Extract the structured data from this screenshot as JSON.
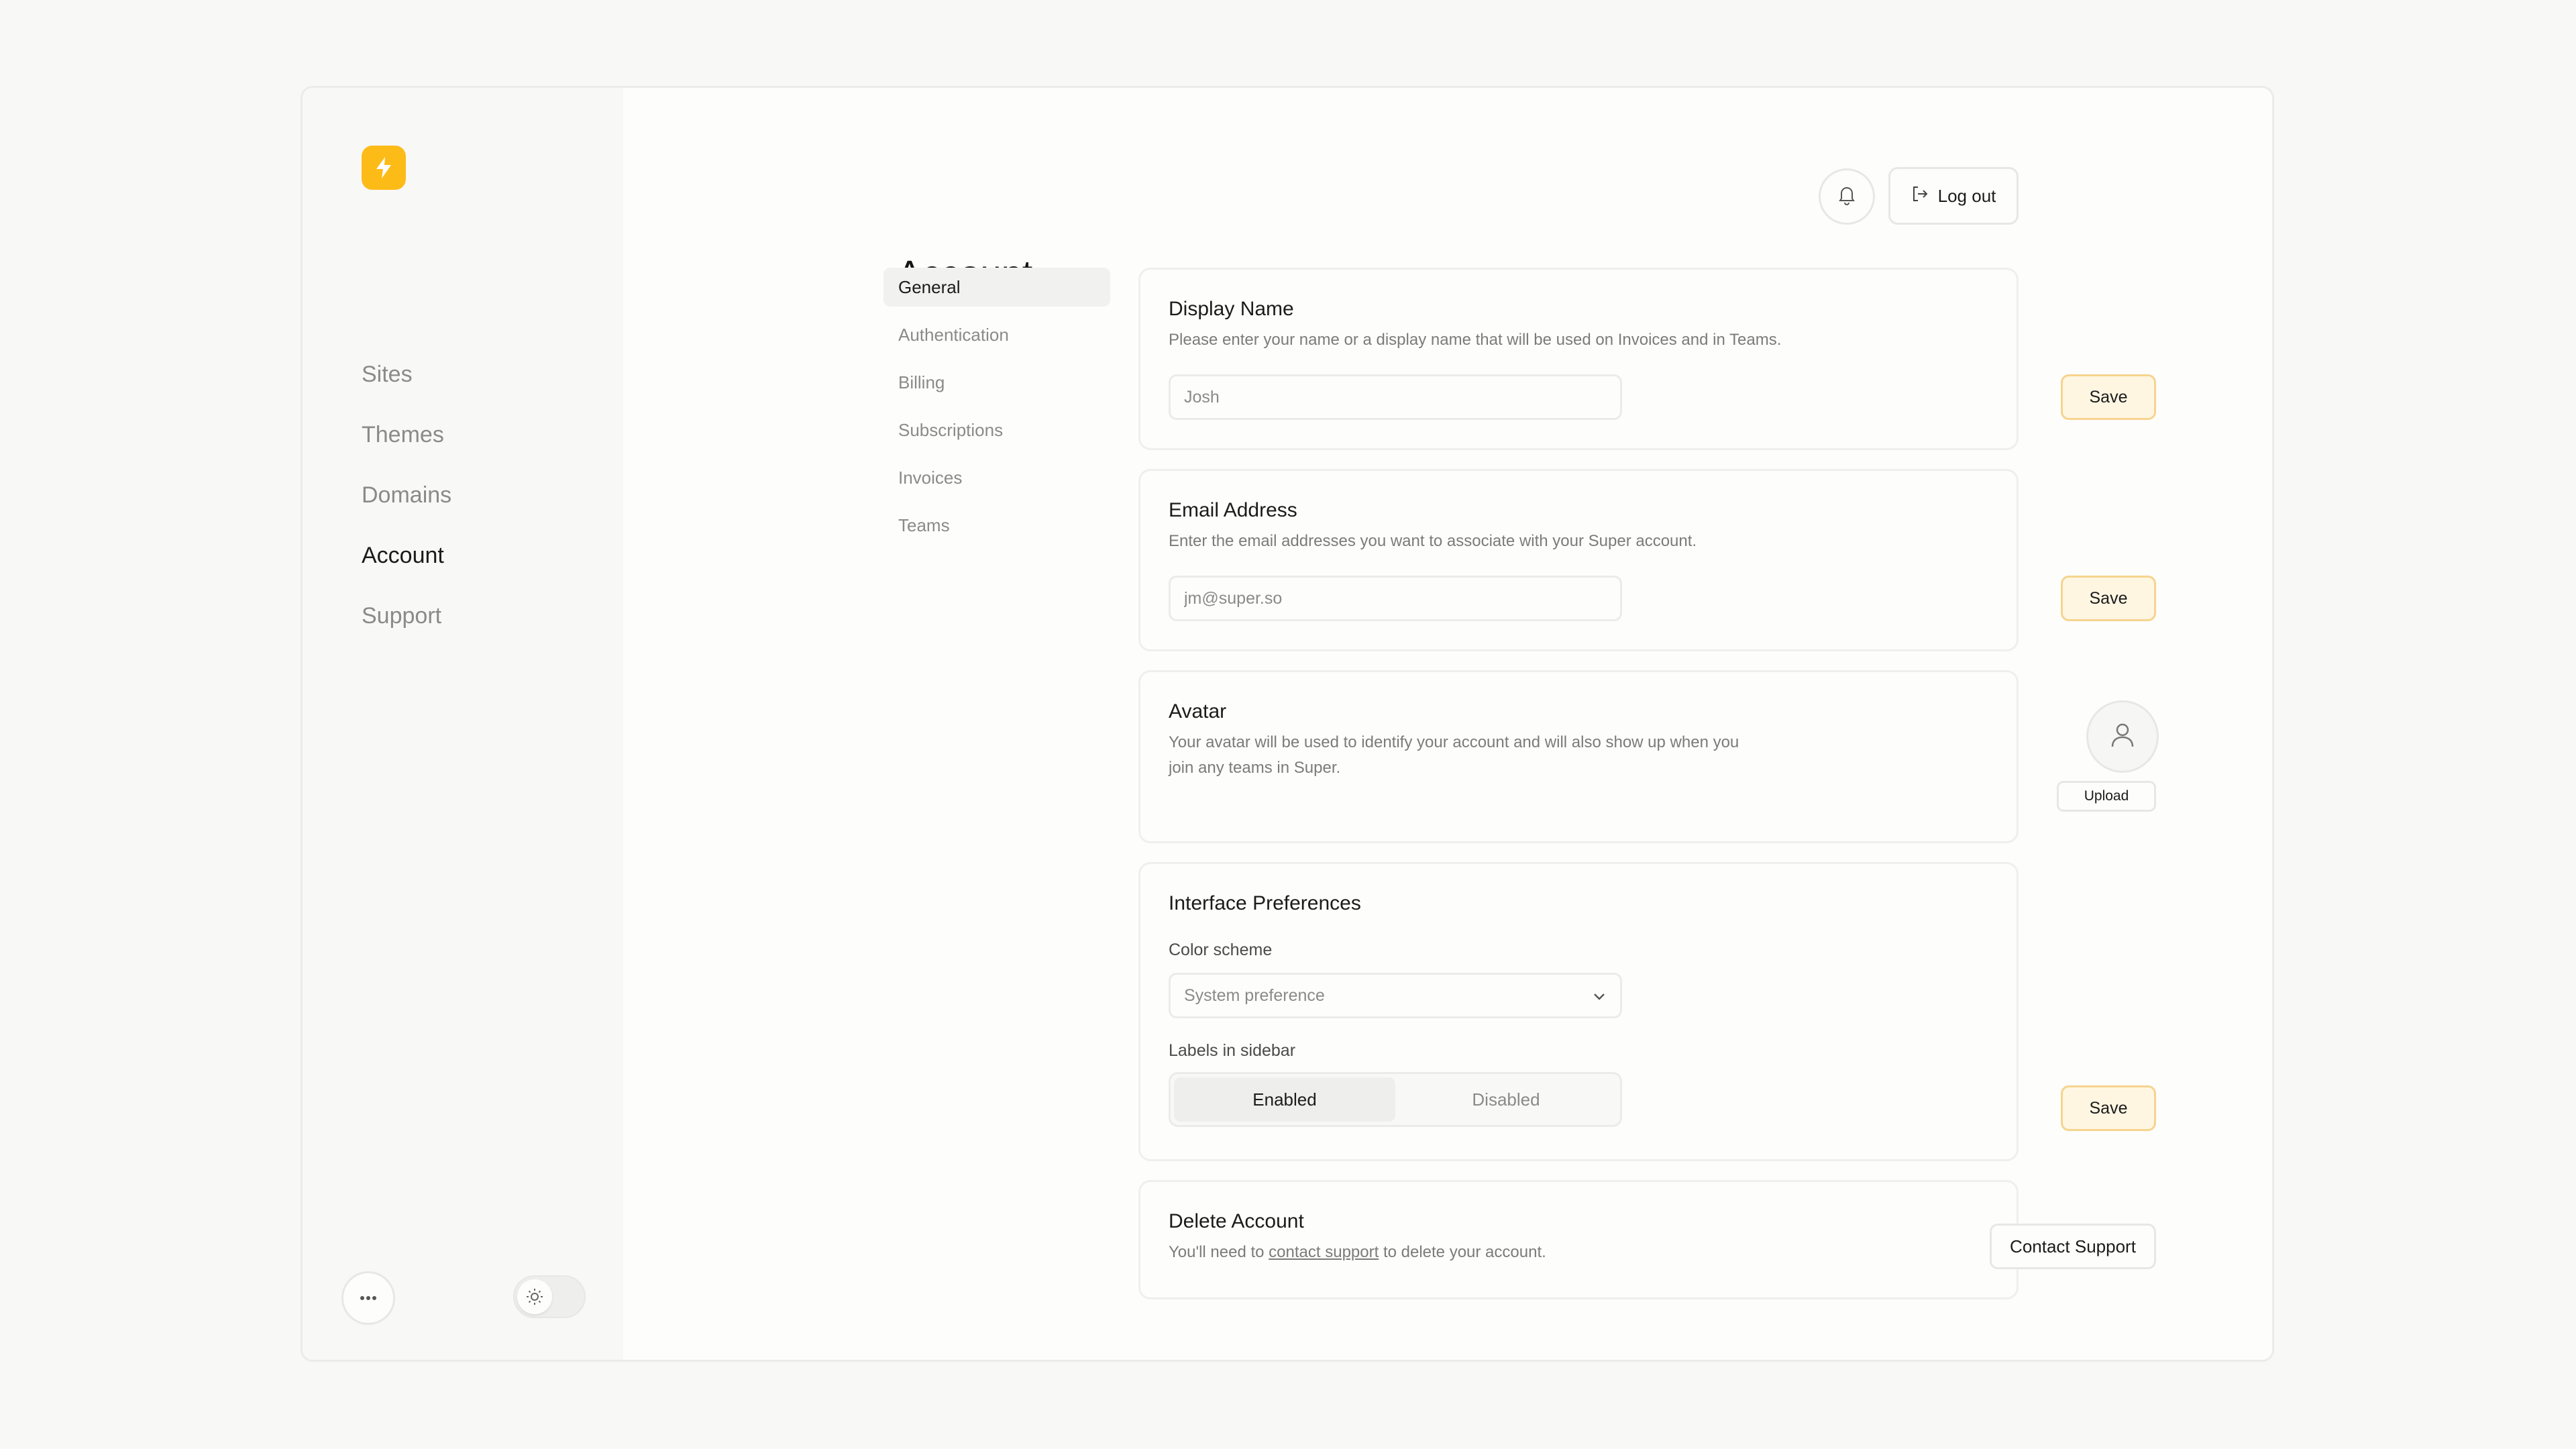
{
  "sidebar": {
    "logo_icon": "lightning-bolt-icon",
    "brand_color": "#fdbb18",
    "items": [
      {
        "label": "Sites",
        "active": false
      },
      {
        "label": "Themes",
        "active": false
      },
      {
        "label": "Domains",
        "active": false
      },
      {
        "label": "Account",
        "active": true
      },
      {
        "label": "Support",
        "active": false
      }
    ],
    "more_icon": "ellipsis-icon",
    "theme_icon": "sun-icon"
  },
  "header": {
    "title": "Account",
    "bell_icon": "bell-icon",
    "logout_label": "Log out",
    "logout_icon": "logout-icon"
  },
  "subnav": {
    "items": [
      {
        "label": "General",
        "active": true
      },
      {
        "label": "Authentication",
        "active": false
      },
      {
        "label": "Billing",
        "active": false
      },
      {
        "label": "Subscriptions",
        "active": false
      },
      {
        "label": "Invoices",
        "active": false
      },
      {
        "label": "Teams",
        "active": false
      }
    ]
  },
  "display_name": {
    "title": "Display Name",
    "description": "Please enter your name or a display name that will be used on Invoices and in Teams.",
    "value": "Josh",
    "save_label": "Save"
  },
  "email": {
    "title": "Email Address",
    "description": "Enter the email addresses you want to associate with your Super account.",
    "value": "jm@super.so",
    "save_label": "Save"
  },
  "avatar": {
    "title": "Avatar",
    "description": "Your avatar will be used to identify your account and will also show up when you join any teams in Super.",
    "upload_label": "Upload",
    "icon": "user-icon"
  },
  "preferences": {
    "title": "Interface Preferences",
    "color_scheme_label": "Color scheme",
    "color_scheme_value": "System preference",
    "labels_label": "Labels in sidebar",
    "enabled_label": "Enabled",
    "disabled_label": "Disabled",
    "selected": "Enabled",
    "save_label": "Save"
  },
  "delete_account": {
    "title": "Delete Account",
    "description_prefix": "You'll need to",
    "link_text": "contact support",
    "description_suffix": "to delete your account.",
    "contact_label": "Contact Support"
  },
  "colors": {
    "accent": "#fdbb18",
    "save_bg": "#fff6e2",
    "save_border": "#f6d48e"
  }
}
